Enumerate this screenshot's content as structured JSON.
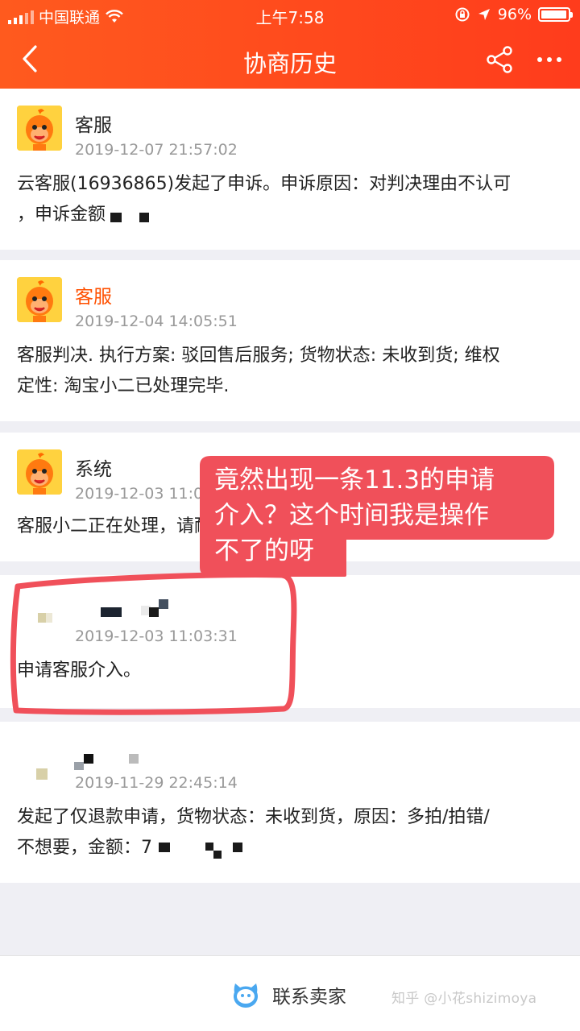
{
  "status_bar": {
    "carrier": "中国联通",
    "time": "上午7:58",
    "battery": "96%",
    "battery_level": 0.96
  },
  "nav": {
    "title": "协商历史",
    "icons": [
      "back-arrow-icon",
      "share-icon",
      "more-icon"
    ]
  },
  "entries": [
    {
      "name": "客服",
      "time": "2019-12-07 21:57:02",
      "content_line1": "云客服(16936865)发起了申诉。申诉原因：对判决理由不认可",
      "content_line2": "，申诉金额"
    },
    {
      "name": "客服",
      "time": "2019-12-04 14:05:51",
      "content_line1": "客服判决. 执行方案: 驳回售后服务; 货物状态: 未收到货; 维权",
      "content_line2": "定性: 淘宝小二已处理完毕."
    },
    {
      "name": "系统",
      "time": "2019-12-03 11:03",
      "content_line1": "客服小二正在处理，请耐心等待。",
      "content_line2": ""
    },
    {
      "name": "",
      "time": "2019-12-03 11:03:31",
      "content_line1": "申请客服介入。",
      "content_line2": ""
    },
    {
      "name": "",
      "time": "2019-11-29 22:45:14",
      "content_line1": "发起了仅退款申请，货物状态：未收到货，原因：多拍/拍错/",
      "content_line2": "不想要，金额：7"
    }
  ],
  "annotation": {
    "callout_line1": "竟然出现一条11.3的申请",
    "callout_line2": "介入？这个时间我是操作",
    "callout_line3": "不了的呀",
    "color": "#f0505a"
  },
  "bottom": {
    "contact_label": "联系卖家",
    "watermark": "知乎 @小花shizimoya"
  },
  "colors": {
    "header": "#ff4a1d",
    "accent_name": "#ff5000",
    "background": "#efeff4"
  }
}
